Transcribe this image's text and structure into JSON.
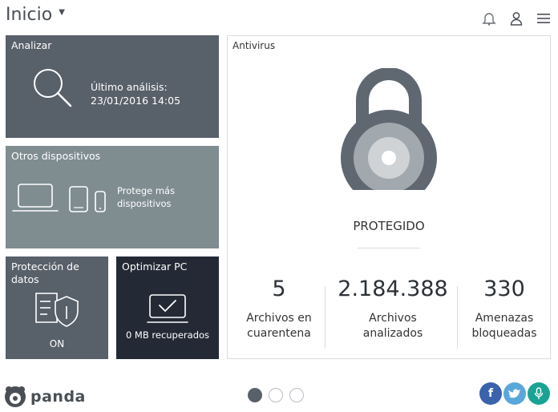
{
  "header": {
    "title": "Inicio",
    "icons": [
      "notification-icon",
      "user-icon",
      "menu-icon"
    ]
  },
  "tiles": {
    "analizar": {
      "title": "Analizar",
      "line1": "Último análisis:",
      "line2": "23/01/2016 14:05"
    },
    "otros": {
      "title": "Otros dispositivos",
      "line1": "Protege más",
      "line2": "dispositivos"
    },
    "proteccion": {
      "title": "Protección de datos",
      "status": "ON"
    },
    "optimizar": {
      "title": "Optimizar PC",
      "status": "0 MB recuperados"
    }
  },
  "antivirus": {
    "title": "Antivirus",
    "state": "PROTEGIDO",
    "stats": [
      {
        "value": "5",
        "label1": "Archivos en",
        "label2": "cuarentena"
      },
      {
        "value": "2.184.388",
        "label1": "Archivos",
        "label2": "analizados"
      },
      {
        "value": "330",
        "label1": "Amenazas",
        "label2": "bloqueadas"
      }
    ]
  },
  "footer": {
    "brand": "panda",
    "pages": 3,
    "active_page": 1,
    "social": [
      {
        "name": "facebook",
        "glyph": "f",
        "color": "#3b62ac"
      },
      {
        "name": "twitter",
        "glyph": "t",
        "color": "#5ba7d9"
      },
      {
        "name": "microphone",
        "glyph": "",
        "color": "#1aa394"
      }
    ]
  },
  "colors": {
    "tile_dark": "#58606a",
    "tile_light": "#7f8d91",
    "tile_navy": "#232a35",
    "lock": "#5f6770"
  }
}
